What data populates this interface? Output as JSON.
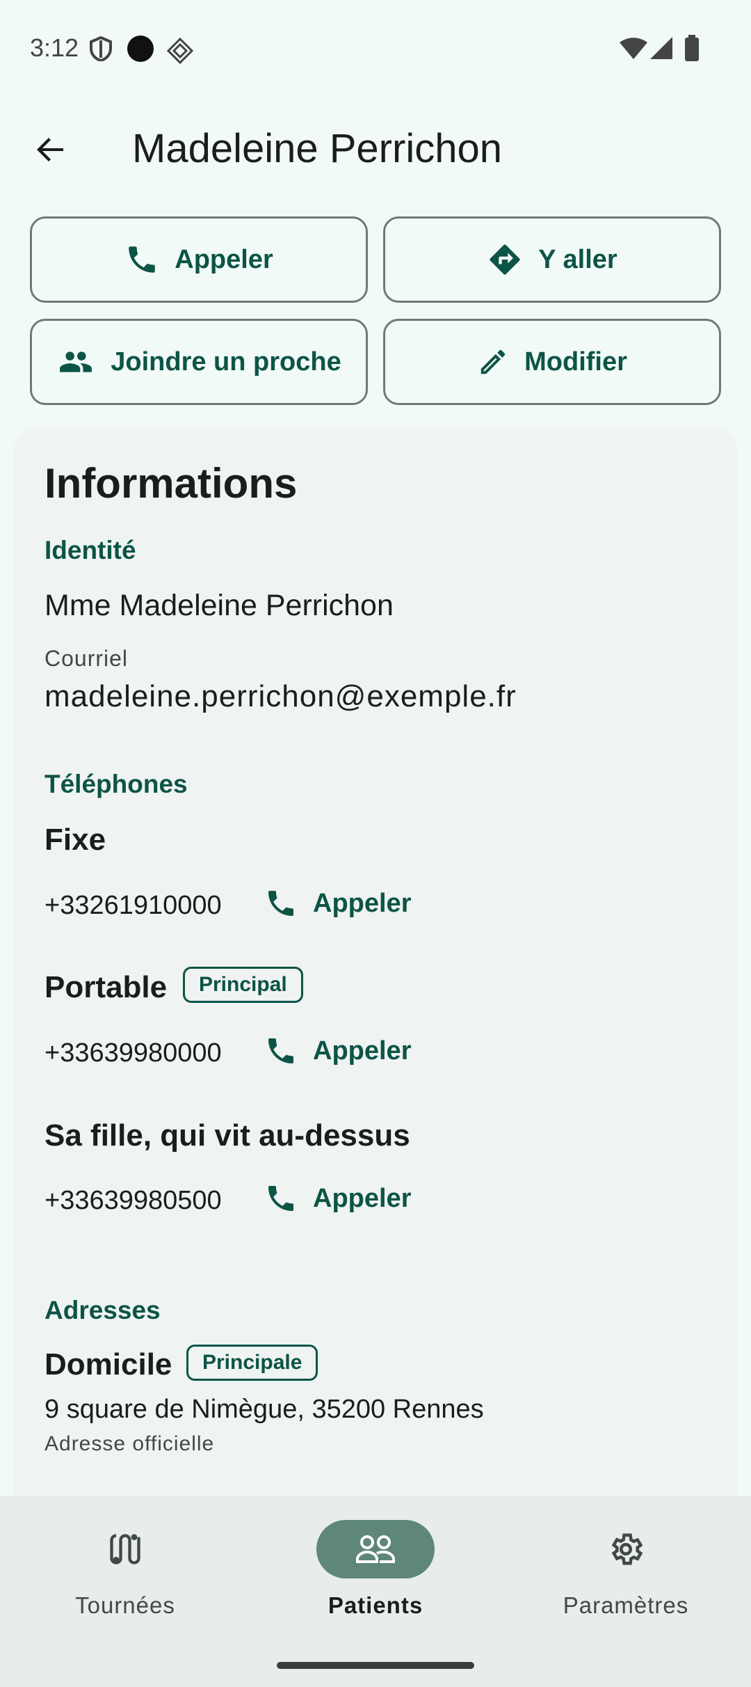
{
  "status_bar": {
    "time": "3:12"
  },
  "header": {
    "title": "Madeleine Perrichon"
  },
  "actions": {
    "call": "Appeler",
    "go": "Y aller",
    "join": "Joindre un proche",
    "edit": "Modifier"
  },
  "info": {
    "title": "Informations",
    "identity_label": "Identité",
    "identity_name": "Mme Madeleine Perrichon",
    "email_label": "Courriel",
    "email": "madeleine.perrichon@exemple.fr",
    "phones_label": "Téléphones",
    "phones": [
      {
        "label": "Fixe",
        "number": "+33261910000",
        "action": "Appeler"
      },
      {
        "label": "Portable",
        "badge": "Principal",
        "number": "+33639980000",
        "action": "Appeler"
      },
      {
        "label": "Sa fille, qui vit au-dessus",
        "number": "+33639980500",
        "action": "Appeler"
      }
    ],
    "addresses_label": "Adresses",
    "address": {
      "label": "Domicile",
      "badge": "Principale",
      "line": "9 square de Nimègue, 35200 Rennes",
      "note": "Adresse officielle"
    }
  },
  "nav": {
    "items": [
      {
        "label": "Tournées",
        "icon": "route-icon"
      },
      {
        "label": "Patients",
        "icon": "people-icon",
        "active": true
      },
      {
        "label": "Paramètres",
        "icon": "gear-icon"
      }
    ]
  },
  "colors": {
    "accent": "#0c5446",
    "background": "#f1faf7",
    "nav_active": "#5e867b"
  }
}
